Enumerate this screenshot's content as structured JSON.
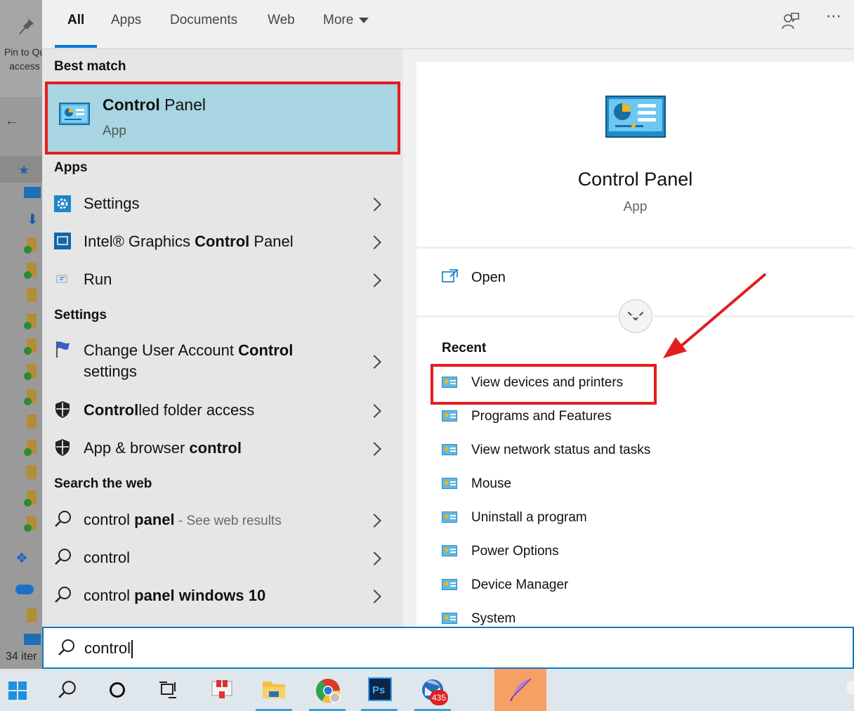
{
  "explorer": {
    "pin_label": "Pin to Qu\naccess",
    "items_count": "34 iter"
  },
  "tabs": [
    {
      "label": "All",
      "active": true
    },
    {
      "label": "Apps"
    },
    {
      "label": "Documents"
    },
    {
      "label": "Web"
    },
    {
      "label": "More"
    }
  ],
  "sections": {
    "best_match": "Best match",
    "apps": "Apps",
    "settings": "Settings",
    "search_web": "Search the web"
  },
  "best_match": {
    "title_bold": "Control",
    "title_rest": " Panel",
    "subtitle": "App"
  },
  "apps": [
    {
      "pre": "Settings",
      "bold": "",
      "post": "",
      "icon": "gear-icon"
    },
    {
      "pre": "Intel® Graphics ",
      "bold": "Control",
      "post": " Panel",
      "icon": "intel-graphics-icon"
    },
    {
      "pre": "Run",
      "bold": "",
      "post": "",
      "icon": "run-icon"
    }
  ],
  "settings": [
    {
      "line1_pre": "Change User Account ",
      "line1_bold": "Control",
      "line2": "settings",
      "icon": "uac-flag-icon"
    },
    {
      "pre": "",
      "bold": "Control",
      "post": "led folder access",
      "icon": "shield-icon"
    },
    {
      "pre": "App & browser ",
      "bold": "control",
      "post": "",
      "icon": "shield-icon"
    }
  ],
  "web": [
    {
      "pre": "control ",
      "bold": "panel",
      "suffix": " - See web results"
    },
    {
      "pre": "control",
      "bold": "",
      "suffix": ""
    },
    {
      "pre": "control ",
      "bold": "panel windows 10",
      "suffix": ""
    }
  ],
  "preview": {
    "title": "Control Panel",
    "subtitle": "App",
    "open_label": "Open",
    "recent_heading": "Recent",
    "recent": [
      "View devices and printers",
      "Programs and Features",
      "View network status and tasks",
      "Mouse",
      "Uninstall a program",
      "Power Options",
      "Device Manager",
      "System"
    ]
  },
  "search": {
    "value": "control"
  },
  "taskbar": {
    "notification_count": "435"
  },
  "colors": {
    "accent": "#0078d7",
    "best_match_bg": "#a8d5e1",
    "highlight_red": "#e21e1e"
  }
}
